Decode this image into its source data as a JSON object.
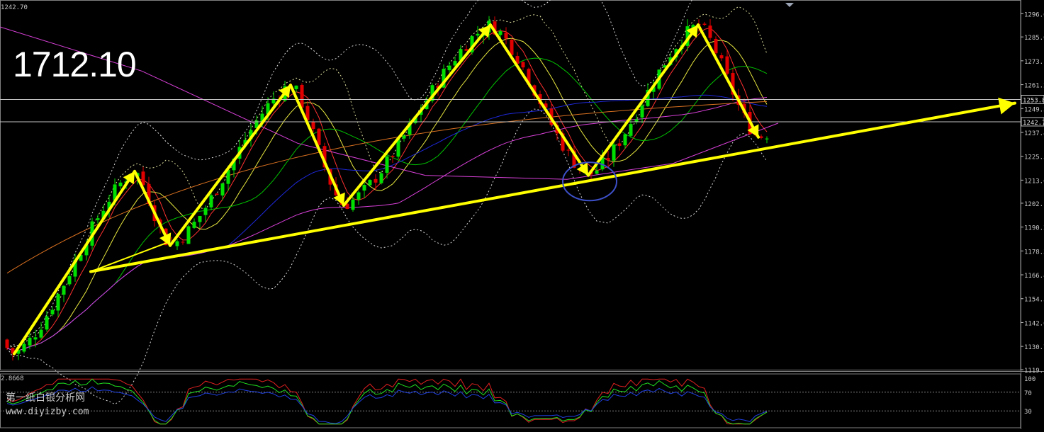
{
  "chart_data": [
    {
      "type": "candlestick",
      "corner_value": "1242.70",
      "headline_value": "1712.10",
      "y_tick_labels": [
        "1296.6",
        "1285.0",
        "1273.1",
        "1261.2",
        "1249.3",
        "1237.4",
        "1225.5",
        "1213.6",
        "1202.1",
        "1190.2",
        "1178.3",
        "1166.4",
        "1154.5",
        "1142.6",
        "1130.7",
        "1119.1"
      ],
      "current_price_labels": [
        "1253.8",
        "1242.7"
      ],
      "ylim": [
        1119.1,
        1302
      ],
      "grid": false,
      "annotations": [
        {
          "kind": "zigzag-arrows",
          "color": "#ffff00",
          "swing_points": [
            1127,
            1218,
            1181,
            1261,
            1201,
            1291,
            1216,
            1291,
            1235
          ]
        },
        {
          "kind": "trendline",
          "color": "#ffff00",
          "from": 1168,
          "to": 1252
        },
        {
          "kind": "circle",
          "color": "#3d50c8",
          "around": 1214
        }
      ],
      "colors": {
        "up": "#00e000",
        "down": "#e00000",
        "background": "#000000",
        "bands": "#d8d8d8",
        "ma_fast": "#e8e840",
        "ma_mid": "#00c000",
        "ma_slow": "#1e28d8",
        "ma_long": "#d840d8",
        "ma_orange": "#d87020"
      }
    },
    {
      "type": "line",
      "indicator_value": "2.8668",
      "y_tick_labels": [
        "100",
        "70",
        "30"
      ],
      "ylim": [
        0,
        100
      ],
      "levels": [
        70,
        30
      ],
      "colors": {
        "series_a": "#e02020",
        "series_b": "#20e020",
        "series_c": "#2040e0"
      }
    }
  ],
  "watermark": {
    "line1": "第一纸白银分析网",
    "line2": "www.diyizby.com"
  }
}
